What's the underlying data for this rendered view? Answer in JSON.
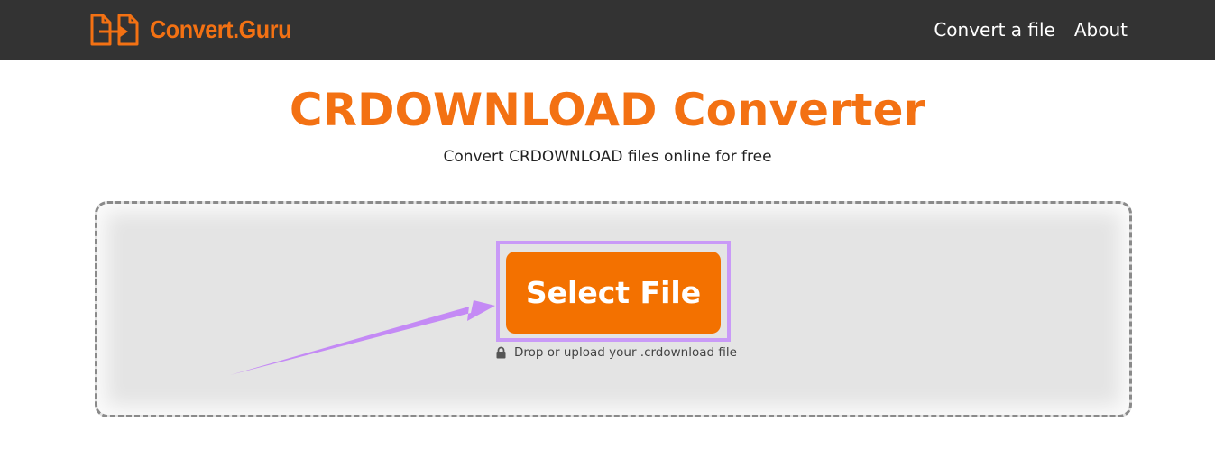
{
  "brand": {
    "name": "Convert.Guru",
    "icon": "file-convert-icon",
    "color": "#f37113"
  },
  "nav": {
    "items": [
      {
        "label": "Convert a file"
      },
      {
        "label": "About"
      }
    ]
  },
  "main": {
    "title": "CRDOWNLOAD Converter",
    "subtitle": "Convert CRDOWNLOAD files online for free",
    "select_button": "Select File",
    "hint": "Drop or upload your .crdownload file",
    "hint_icon": "lock-icon"
  },
  "annotation": {
    "arrow_icon": "pointer-arrow-icon",
    "highlight_color": "#c99af7"
  },
  "colors": {
    "accent": "#f37100",
    "navbar": "#333333",
    "dropzone": "#e4e4e4"
  }
}
